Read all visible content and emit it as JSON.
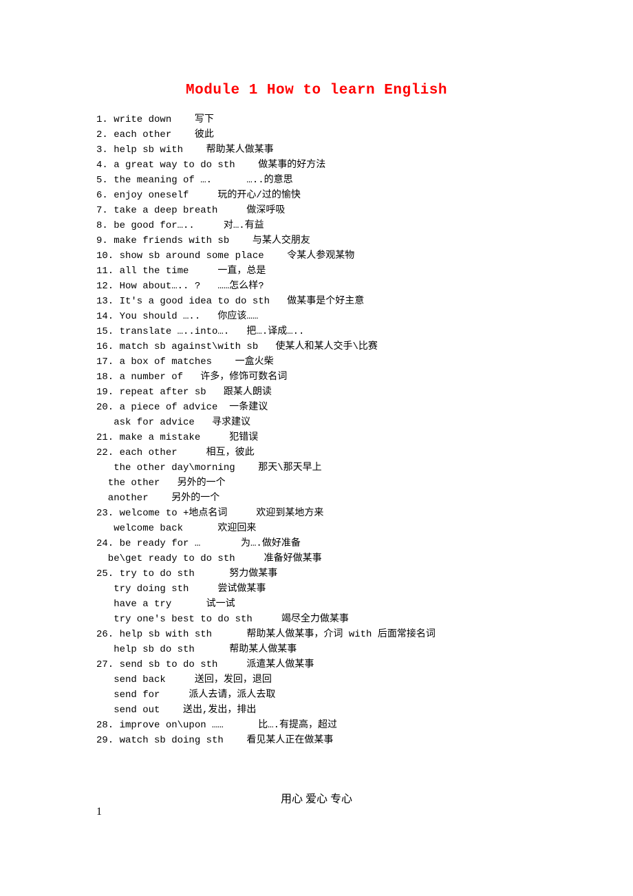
{
  "title": "Module 1   How to learn English",
  "lines": [
    "1. write down    写下",
    "2. each other    彼此",
    "3. help sb with    帮助某人做某事",
    "4. a great way to do sth    做某事的好方法",
    "5. the meaning of ….      …..的意思",
    "6. enjoy oneself     玩的开心/过的愉快",
    "7. take a deep breath     做深呼吸",
    "8. be good for…..     对….有益",
    "9. make friends with sb    与某人交朋友",
    "10. show sb around some place    令某人参观某物",
    "11. all the time     一直，总是",
    "12. How about….. ?   ……怎么样?",
    "13. It's a good idea to do sth   做某事是个好主意",
    "14. You should …..   你应该……",
    "15. translate …..into….   把….译成…..",
    "16. match sb against\\with sb   使某人和某人交手\\比赛",
    "17. a box of matches    一盒火柴",
    "18. a number of   许多，修饰可数名词",
    "19. repeat after sb   跟某人朗读",
    "20. a piece of advice  一条建议",
    "   ask for advice   寻求建议",
    "21. make a mistake     犯错误",
    "22. each other     相互，彼此",
    "   the other day\\morning    那天\\那天早上",
    "  the other   另外的一个",
    "  another    另外的一个",
    "23. welcome to +地点名词     欢迎到某地方来",
    "   welcome back      欢迎回来",
    "24. be ready for …       为….做好准备",
    "  be\\get ready to do sth     准备好做某事",
    "25. try to do sth      努力做某事",
    "   try doing sth     尝试做某事",
    "   have a try      试一试",
    "   try one's best to do sth     竭尽全力做某事",
    "26. help sb with sth      帮助某人做某事，介词 with 后面常接名词",
    "   help sb do sth      帮助某人做某事",
    "27. send sb to do sth     派遣某人做某事",
    "   send back     送回，发回，退回",
    "   send for     派人去请，派人去取",
    "   send out    送出,发出，排出",
    "28. improve on\\upon ……      比….有提高，超过",
    "29. watch sb doing sth    看见某人正在做某事"
  ],
  "footer_text": "用心  爱心  专心",
  "page_number": "1"
}
